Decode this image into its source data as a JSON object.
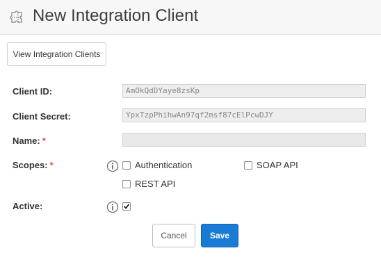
{
  "header": {
    "title": "New Integration Client",
    "icon": "puzzle-icon"
  },
  "toolbar": {
    "view_clients_label": "View Integration Clients"
  },
  "form": {
    "client_id": {
      "label": "Client ID:",
      "value": "AmOkQdDYaye8zsKp"
    },
    "client_secret": {
      "label": "Client Secret:",
      "value": "YpxTzpPhihwAn97qf2msf87cElPcwDJY"
    },
    "name": {
      "label": "Name:",
      "required_mark": "*",
      "value": ""
    },
    "scopes": {
      "label": "Scopes:",
      "required_mark": "*",
      "info_icon": "info-icon",
      "options": [
        {
          "label": "Authentication",
          "checked": false
        },
        {
          "label": "SOAP API",
          "checked": false
        },
        {
          "label": "REST API",
          "checked": false
        }
      ]
    },
    "active": {
      "label": "Active:",
      "info_icon": "info-icon",
      "checked": true
    }
  },
  "actions": {
    "cancel_label": "Cancel",
    "save_label": "Save"
  },
  "colors": {
    "primary": "#1a7bd4",
    "required": "#d9534f",
    "header_bg": "#f7f7f7"
  }
}
